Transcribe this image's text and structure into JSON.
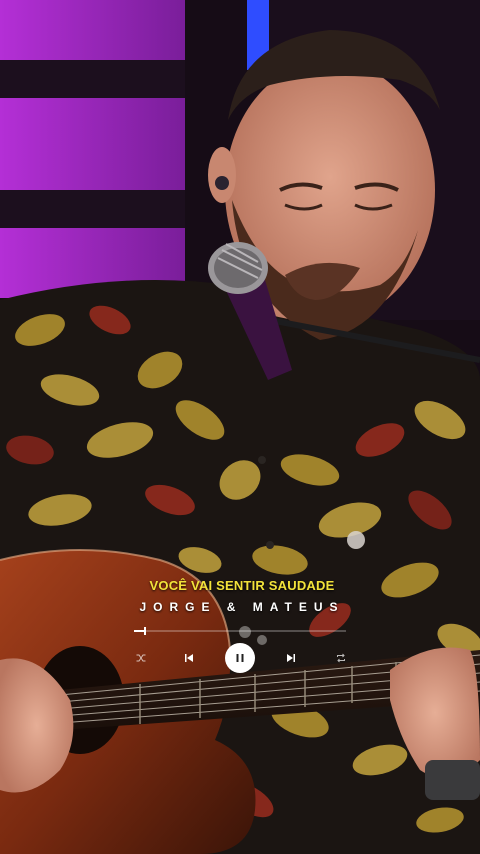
{
  "player": {
    "song_title": "VOCÊ VAI SENTIR SAUDADE",
    "artist": "JORGE & MATEUS",
    "progress": 0.05,
    "is_playing": true
  },
  "controls": {
    "shuffle_icon": "shuffle-icon",
    "previous_icon": "skip-previous-icon",
    "play_pause_icon": "pause-icon",
    "next_icon": "skip-next-icon",
    "repeat_icon": "repeat-icon"
  },
  "colors": {
    "title": "#f2e23a",
    "artist": "#ffffff",
    "background_accent": "#c23be0"
  }
}
